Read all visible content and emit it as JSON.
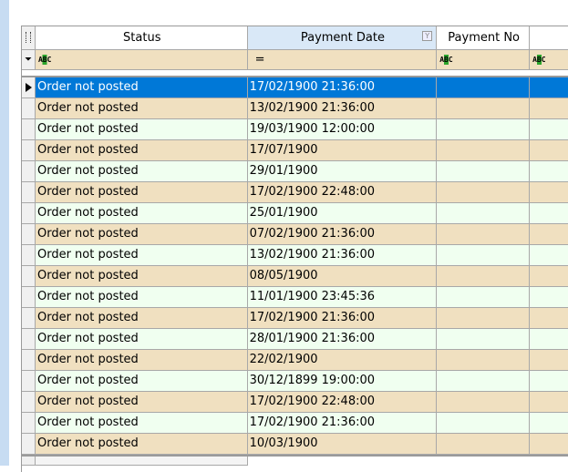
{
  "columns": [
    {
      "label": "Status"
    },
    {
      "label": "Payment Date"
    },
    {
      "label": "Payment No"
    },
    {
      "label": ""
    }
  ],
  "filter_row": {
    "status": "ABC",
    "payment_date": "=",
    "payment_no": "ABC",
    "extra": "ABC"
  },
  "selected_row_index": 0,
  "colors": {
    "selected": "#0078d7",
    "odd_row": "#f0e0c0",
    "even_row": "#f0fff0",
    "header_active": "#d9e8f7"
  },
  "rows": [
    {
      "status": "Order not posted",
      "payment_date": "17/02/1900 21:36:00"
    },
    {
      "status": "Order not posted",
      "payment_date": "13/02/1900 21:36:00"
    },
    {
      "status": "Order not posted",
      "payment_date": "19/03/1900 12:00:00"
    },
    {
      "status": "Order not posted",
      "payment_date": "17/07/1900"
    },
    {
      "status": "Order not posted",
      "payment_date": "29/01/1900"
    },
    {
      "status": "Order not posted",
      "payment_date": "17/02/1900 22:48:00"
    },
    {
      "status": "Order not posted",
      "payment_date": "25/01/1900"
    },
    {
      "status": "Order not posted",
      "payment_date": "07/02/1900 21:36:00"
    },
    {
      "status": "Order not posted",
      "payment_date": "13/02/1900 21:36:00"
    },
    {
      "status": "Order not posted",
      "payment_date": "08/05/1900"
    },
    {
      "status": "Order not posted",
      "payment_date": "11/01/1900 23:45:36"
    },
    {
      "status": "Order not posted",
      "payment_date": "17/02/1900 21:36:00"
    },
    {
      "status": "Order not posted",
      "payment_date": "28/01/1900 21:36:00"
    },
    {
      "status": "Order not posted",
      "payment_date": "22/02/1900"
    },
    {
      "status": "Order not posted",
      "payment_date": "30/12/1899 19:00:00"
    },
    {
      "status": "Order not posted",
      "payment_date": "17/02/1900 22:48:00"
    },
    {
      "status": "Order not posted",
      "payment_date": "17/02/1900 21:36:00"
    },
    {
      "status": "Order not posted",
      "payment_date": "10/03/1900"
    }
  ]
}
